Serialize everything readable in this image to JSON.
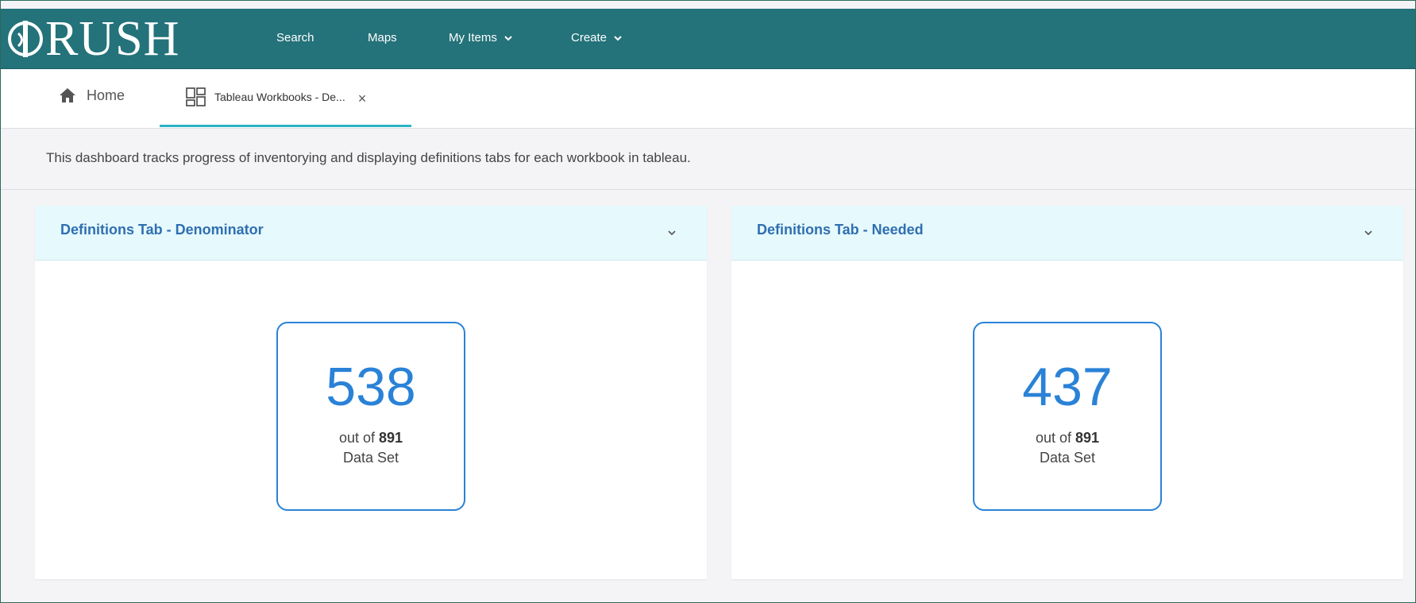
{
  "app": {
    "logo_text": "RUSH"
  },
  "navbar": {
    "items": [
      {
        "label": "Search"
      },
      {
        "label": "Maps"
      },
      {
        "label": "My Items"
      },
      {
        "label": "Create"
      }
    ]
  },
  "tabs": {
    "home_label": "Home",
    "active_label": "Tableau Workbooks - De...",
    "close_glyph": "×"
  },
  "description": "This dashboard tracks progress of inventorying and displaying definitions tabs for each workbook in tableau.",
  "cards": [
    {
      "title": "Definitions Tab - Denominator",
      "value": "538",
      "out_of_prefix": "out of",
      "total": "891",
      "unit": "Data Set"
    },
    {
      "title": "Definitions Tab - Needed",
      "value": "437",
      "out_of_prefix": "out of",
      "total": "891",
      "unit": "Data Set"
    }
  ],
  "icons": {
    "home": "home-icon",
    "workbook": "dashboard-grid-icon",
    "chevron": "chevron-down-icon",
    "close": "close-icon"
  },
  "colors": {
    "navbar": "#24727a",
    "accent": "#2a82d7",
    "card_header": "#e6f9fc",
    "tab_underline": "#2bb3c6"
  }
}
